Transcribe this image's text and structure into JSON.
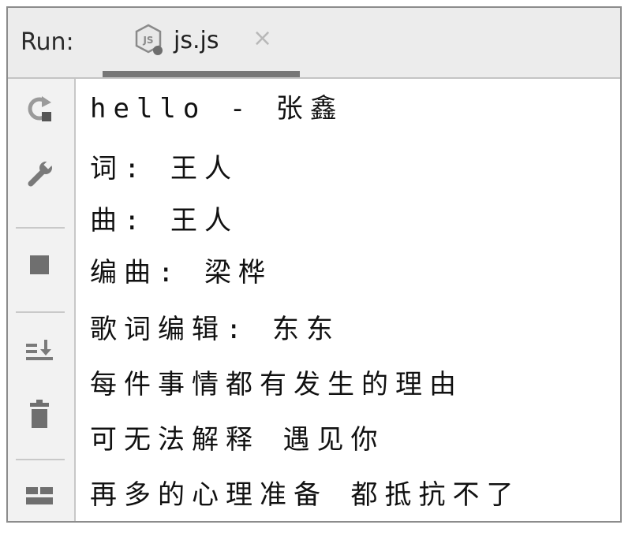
{
  "header": {
    "run_label": "Run:",
    "tab": {
      "title": "js.js",
      "icon": "nodejs-file-icon",
      "close_glyph": "×"
    }
  },
  "toolbar": {
    "buttons": [
      {
        "name": "rerun-icon"
      },
      {
        "name": "wrench-icon"
      },
      {
        "name": "stop-icon"
      },
      {
        "name": "scroll-to-end-icon"
      },
      {
        "name": "trash-icon"
      },
      {
        "name": "layout-icon"
      }
    ]
  },
  "console": {
    "lines": [
      "hello - 张鑫",
      "词: 王人",
      "曲: 王人",
      "编曲: 梁桦",
      "歌词编辑: 东东",
      "每件事情都有发生的理由",
      "可无法解释 遇见你",
      "再多的心理准备 都抵抗不了"
    ]
  },
  "colors": {
    "header_bg": "#ececec",
    "toolbar_bg": "#f2f2f2",
    "tab_underline": "#777777",
    "text": "#111111"
  }
}
